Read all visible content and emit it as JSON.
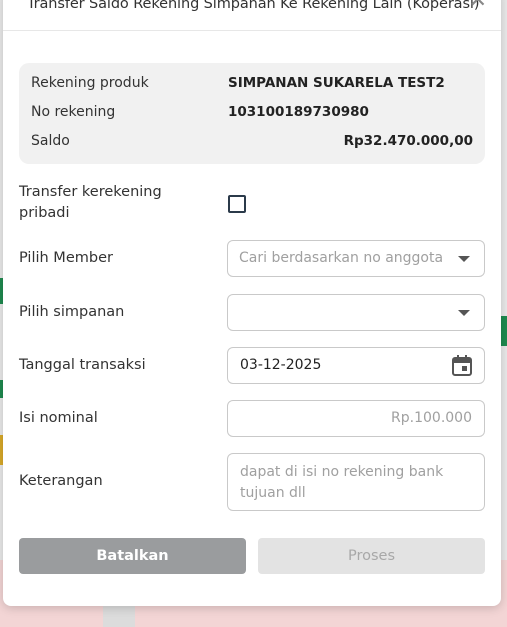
{
  "dialog": {
    "title": "Transfer Saldo Rekening Simpanan Ke Rekening Lain (Koperasi)",
    "close_symbol": "✕"
  },
  "info": {
    "rows": [
      {
        "label": "Rekening produk",
        "value": "SIMPANAN SUKARELA TEST2"
      },
      {
        "label": "No rekening",
        "value": "103100189730980"
      },
      {
        "label": "Saldo",
        "value": "Rp32.470.000,00"
      }
    ]
  },
  "form": {
    "transfer_own_label": "Transfer kerekening pribadi",
    "transfer_own_checked": false,
    "member_label": "Pilih Member",
    "member_placeholder": "Cari berdasarkan no anggota",
    "simpanan_label": "Pilih simpanan",
    "simpanan_value": "",
    "date_label": "Tanggal transaksi",
    "date_value": "03-12-2025",
    "nominal_label": "Isi nominal",
    "nominal_placeholder": "Rp.100.000",
    "note_label": "Keterangan",
    "note_placeholder": "dapat di isi no rekening bank tujuan dll"
  },
  "actions": {
    "cancel_label": "Batalkan",
    "process_label": "Proses"
  },
  "icons": {
    "close": "close-icon",
    "caret": "chevron-down-icon",
    "calendar": "calendar-icon"
  },
  "colors": {
    "cancel_bg": "#9a9c9e",
    "process_bg": "#e3e3e3",
    "card_bg": "#f1f1f1"
  }
}
